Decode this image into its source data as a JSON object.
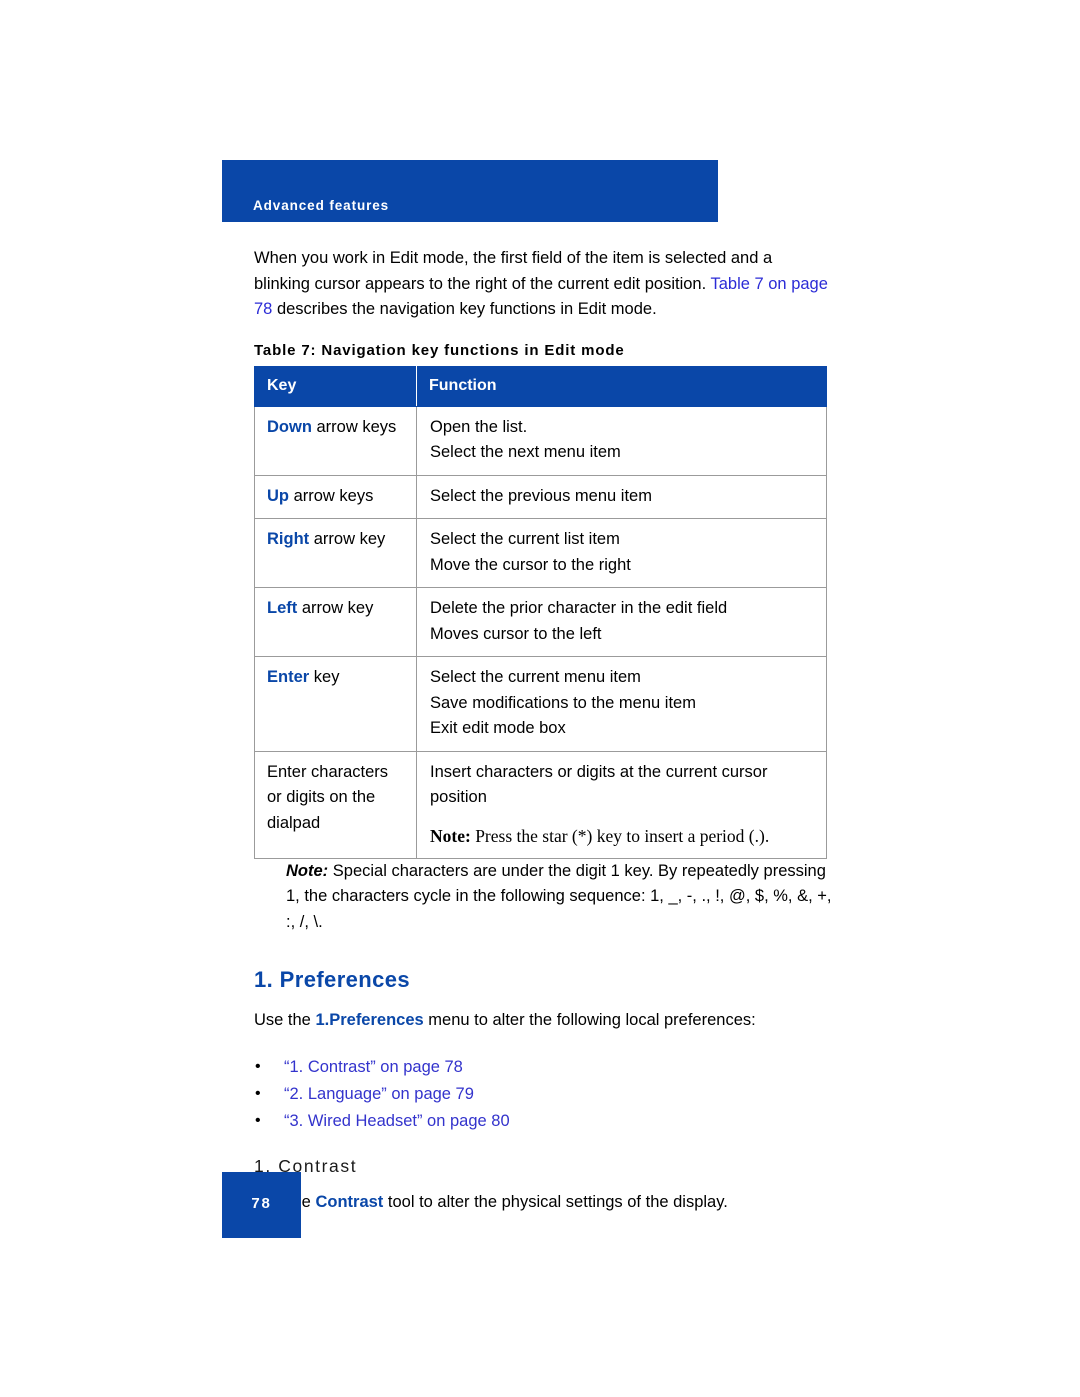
{
  "header": {
    "banner_title": "Advanced features",
    "banner_color": "#0a47a8"
  },
  "intro": {
    "part1": "When you work in Edit mode, the first field of the item is selected and a blinking cursor appears to the right of the current edit position. ",
    "link1": "Table 7 on page 78",
    "part2": " describes the navigation key functions in Edit mode."
  },
  "table": {
    "caption": "Table 7: Navigation key functions in Edit mode",
    "headers": [
      "Key",
      "Function"
    ],
    "rows": [
      {
        "key_bold": "Down",
        "key_rest": " arrow keys",
        "lines": [
          "Open the list.",
          "Select the next menu item"
        ]
      },
      {
        "key_bold": "Up",
        "key_rest": " arrow keys",
        "lines": [
          "Select the previous menu item"
        ]
      },
      {
        "key_bold": "Right",
        "key_rest": " arrow key",
        "lines": [
          "Select the current list item",
          "Move the cursor to the right"
        ]
      },
      {
        "key_bold": "Left",
        "key_rest": " arrow key",
        "lines": [
          "Delete the prior character in the edit field",
          "Moves cursor to the left"
        ]
      },
      {
        "key_bold": "Enter",
        "key_rest": " key",
        "lines": [
          "Select the current menu item",
          "Save modifications to the menu item",
          "Exit edit mode box"
        ]
      },
      {
        "key_bold": "",
        "key_rest": "Enter characters or digits on the dialpad",
        "lines": [
          "Insert characters or digits at the current cursor position"
        ],
        "note_lead": "Note:",
        "note_text": " Press the star (*) key to insert a period (.)."
      }
    ]
  },
  "note": {
    "lead": "Note:",
    "text": " Special characters are under the digit 1 key. By repeatedly pressing 1, the characters cycle in the following sequence: 1, _, -, ., !, @, $, %, &, +, :, /, \\."
  },
  "preferences": {
    "heading": "1. Preferences",
    "intro_before": "Use the ",
    "intro_bold": "1.Preferences",
    "intro_after": " menu to alter the following local preferences:",
    "links": [
      "“1. Contrast” on page 78",
      "“2. Language” on page 79",
      "“3. Wired Headset” on page 80"
    ],
    "bullet_glyph": "•"
  },
  "contrast": {
    "heading": "1. Contrast",
    "body_before": "Use the ",
    "body_bold": "Contrast",
    "body_after": " tool to alter the physical settings of the display."
  },
  "footer": {
    "page_number": "78"
  }
}
